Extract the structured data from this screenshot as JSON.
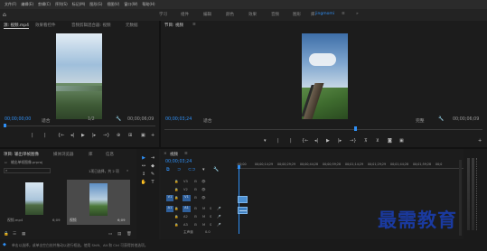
{
  "menu": [
    "文件(F)",
    "编辑(E)",
    "剪辑(C)",
    "序列(S)",
    "标记(M)",
    "图形(G)",
    "视图(V)",
    "窗口(W)",
    "帮助(H)"
  ],
  "workspaces": [
    "学习",
    "组件",
    "编辑",
    "颜色",
    "效果",
    "音频",
    "图形",
    "库",
    "jingmomi"
  ],
  "source_panel": {
    "tabs": [
      "源: 视频.mp4",
      "效果看控件",
      "音频剪辑混合器: 视频",
      "元数据"
    ],
    "timecode_left": "00;00;00;00",
    "fit_label": "适合",
    "ratio_label": "1/2",
    "timecode_right": "00;00;06;09"
  },
  "program_panel": {
    "title": "节目: 视频",
    "timecode_left": "00;00;03;24",
    "fit_label": "适合",
    "quality_label": "完整",
    "timecode_right": "00;00;06;09"
  },
  "project_panel": {
    "tabs": [
      "项目: 输出单帧图像",
      "媒体浏览器",
      "库",
      "信息"
    ],
    "path": "输出单帧图像.prproj",
    "selection": "1项已选择，共 2 项",
    "items": [
      {
        "name": "视频.mp4",
        "duration": "6;09"
      },
      {
        "name": "视频",
        "duration": "6;09"
      }
    ]
  },
  "timeline": {
    "title": "视频",
    "timecode": "00;00;03;24",
    "ruler": [
      ":00;00",
      "00;00;14;29",
      "00;00;29;29",
      "00;00;44;28",
      "00;00;59;28",
      "00;01;14;29",
      "00;01;29;29",
      "00;01;44;28",
      "00;01;59;28",
      "00;0"
    ],
    "video_tracks": [
      "V3",
      "V2",
      "V1"
    ],
    "audio_tracks": [
      "A1",
      "A2",
      "A3"
    ],
    "master_label": "主声道",
    "master_value": "0.0"
  },
  "status_text": "单击以选择，或单击空白处并拖动以进行框选。使用 Shift、Alt 和 Ctrl 可获得其他选项。",
  "watermark": "最需教育"
}
